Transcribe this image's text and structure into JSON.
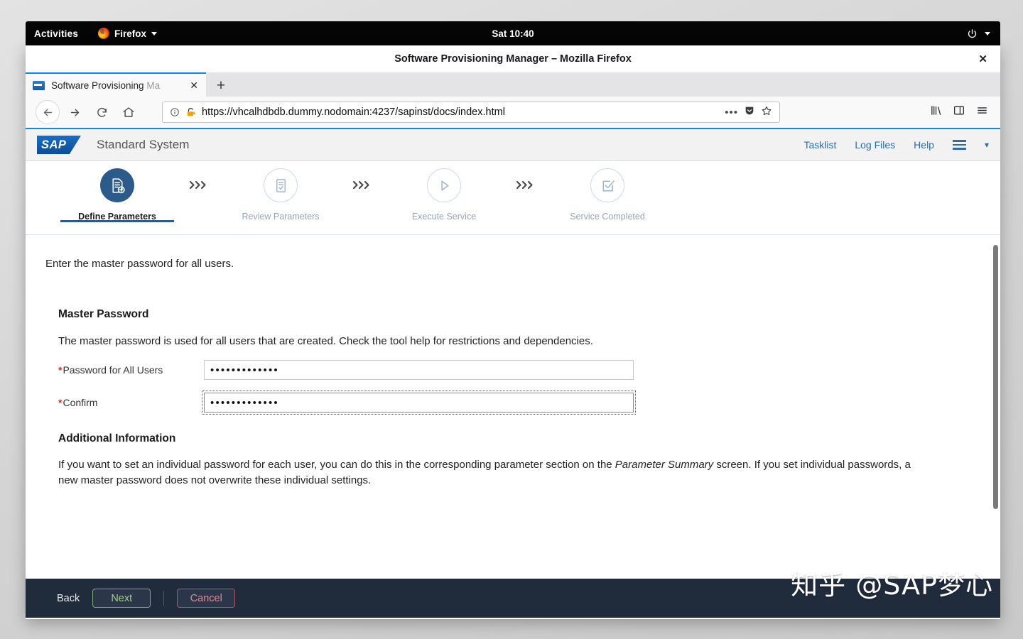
{
  "desktop": {
    "activities": "Activities",
    "app_menu": "Firefox",
    "clock": "Sat 10:40",
    "power_icon": "power-icon",
    "caret_icon": "chevron-down-icon"
  },
  "browser": {
    "window_title": "Software Provisioning Manager – Mozilla Firefox",
    "close_label": "✕",
    "tab": {
      "title_strong": "Software Provisioning ",
      "title_fade": "Ma",
      "close": "✕",
      "favicon": "sap-favicon"
    },
    "new_tab_label": "+",
    "nav": {
      "back": "back-arrow-icon",
      "forward": "forward-arrow-icon",
      "reload": "reload-icon",
      "home": "home-icon"
    },
    "url": "https://vhcalhdbdb.dummy.nodomain:4237/sapinst/docs/index.html",
    "url_icons": [
      "info-icon",
      "insecure-lock-warning-icon"
    ],
    "url_actions": [
      "page-actions-ellipsis-icon",
      "pocket-icon",
      "bookmark-star-icon"
    ],
    "toolbar_right": [
      "library-icon",
      "sidebar-icon",
      "app-menu-icon"
    ]
  },
  "sap": {
    "logo_text": "SAP",
    "system_title": "Standard System",
    "nav_links": [
      "Tasklist",
      "Log Files",
      "Help"
    ],
    "menu_icon": "hamburger-menu-icon",
    "menu_chevron": "chevron-down-icon"
  },
  "wizard": {
    "steps": [
      {
        "label": "Define Parameters",
        "state": "active",
        "icon": "document-add-icon"
      },
      {
        "label": "Review Parameters",
        "state": "idle",
        "icon": "document-check-icon"
      },
      {
        "label": "Execute Service",
        "state": "idle",
        "icon": "play-icon"
      },
      {
        "label": "Service Completed",
        "state": "idle",
        "icon": "checkbox-check-icon"
      }
    ],
    "separator_icon": "chevrons-right-icon"
  },
  "main": {
    "intro": "Enter the master password for all users.",
    "section_title": "Master Password",
    "section_desc": "The master password is used for all users that are created. Check the tool help for restrictions and dependencies.",
    "fields": [
      {
        "label": "Password for All Users",
        "required": "*",
        "value": "•••••••••••••",
        "focused": false
      },
      {
        "label": "Confirm",
        "required": "*",
        "value": "•••••••••••••",
        "focused": true
      }
    ],
    "additional_title": "Additional Information",
    "additional_text_1": "If you want to set an individual password for each user, you can do this in the corresponding parameter section on the ",
    "additional_text_em": "Parameter Summary",
    "additional_text_2": " screen. If you set individual passwords, a new master password does not overwrite these individual settings."
  },
  "footer": {
    "back": "Back",
    "next": "Next",
    "cancel": "Cancel"
  },
  "watermark": "知乎 @SAP梦心",
  "colors": {
    "sap_blue": "#2c5a8a",
    "accent_tab": "#0a84ff",
    "footer_bg": "#202b3c",
    "next_border": "#7fa86f",
    "cancel_border": "#a95765",
    "required_star": "#c0392b"
  }
}
